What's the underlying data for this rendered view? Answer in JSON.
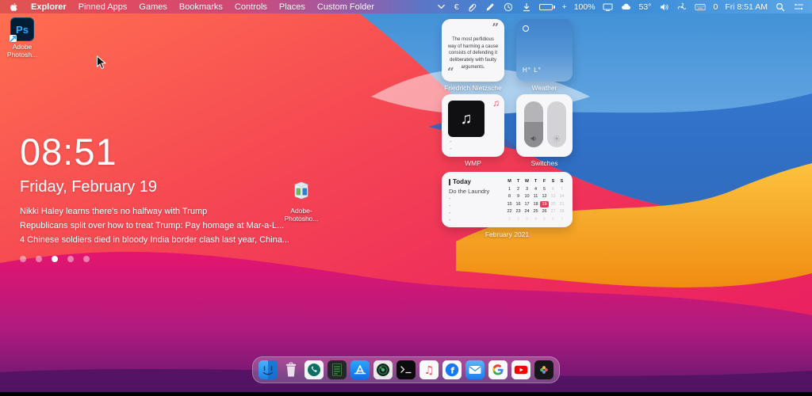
{
  "menubar": {
    "items": [
      "Explorer",
      "Pinned Apps",
      "Games",
      "Bookmarks",
      "Controls",
      "Places",
      "Custom Folder"
    ],
    "active_item": "Explorer",
    "status": {
      "battery_prefix": "+",
      "battery_label": "100%",
      "temperature": "53°",
      "keyboard_count": "0",
      "clock": "Fri 8:51 AM",
      "euro_glyph": "€"
    }
  },
  "desktop": {
    "icons": [
      {
        "type": "photoshop",
        "tile_text": "Ps",
        "label_line1": "Adobe",
        "label_line2": "Photosh..."
      },
      {
        "type": "installer",
        "label_line1": "Adobe-",
        "label_line2": "Photosho..."
      }
    ],
    "clock": {
      "time": "08:51",
      "date": "Friday, February 19"
    },
    "news": [
      "Nikki Haley learns there's no halfway with Trump",
      "Republicans split over how to treat Trump: Pay homage at Mar-a-L...",
      "4 Chinese soldiers died in bloody India border clash last year, China..."
    ],
    "pagination": {
      "count": 5,
      "active": 2
    }
  },
  "widgets": {
    "quote": {
      "text": "The most perfidious way of harming a cause consists of defending it deliberately with faulty arguments.",
      "open_quote": "”",
      "close_quote": "“",
      "label": "Friedrich Nietzsche"
    },
    "weather": {
      "hi_lo": "H° L°",
      "label": "Weather"
    },
    "wmp": {
      "label": "WMP",
      "line1": "-",
      "line2": "-",
      "art_icon": "music-note",
      "corner_icon": "music-note",
      "art_glyph": "♫",
      "corner_glyph": "♫"
    },
    "switches": {
      "label": "Switches",
      "toggles": [
        "volume",
        "brightness"
      ]
    },
    "calendar": {
      "today_label": "Today",
      "event": "Do the Laundry",
      "placeholders": [
        "-",
        "-",
        "-",
        "-"
      ],
      "label": "February 2021",
      "weekdays": [
        "M",
        "T",
        "W",
        "T",
        "F",
        "S",
        "S"
      ],
      "highlight_day": 19,
      "days": [
        {
          "d": 1,
          "s": "n"
        },
        {
          "d": 2,
          "s": "n"
        },
        {
          "d": 3,
          "s": "n"
        },
        {
          "d": 4,
          "s": "n"
        },
        {
          "d": 5,
          "s": "n"
        },
        {
          "d": 6,
          "s": "w"
        },
        {
          "d": 7,
          "s": "w"
        },
        {
          "d": 8,
          "s": "n"
        },
        {
          "d": 9,
          "s": "n"
        },
        {
          "d": 10,
          "s": "n"
        },
        {
          "d": 11,
          "s": "n"
        },
        {
          "d": 12,
          "s": "n"
        },
        {
          "d": 13,
          "s": "w"
        },
        {
          "d": 14,
          "s": "w"
        },
        {
          "d": 15,
          "s": "n"
        },
        {
          "d": 16,
          "s": "n"
        },
        {
          "d": 17,
          "s": "n"
        },
        {
          "d": 18,
          "s": "n"
        },
        {
          "d": 19,
          "s": "a"
        },
        {
          "d": 20,
          "s": "w"
        },
        {
          "d": 21,
          "s": "w"
        },
        {
          "d": 22,
          "s": "n"
        },
        {
          "d": 23,
          "s": "n"
        },
        {
          "d": 24,
          "s": "n"
        },
        {
          "d": 25,
          "s": "n"
        },
        {
          "d": 26,
          "s": "n"
        },
        {
          "d": 27,
          "s": "w"
        },
        {
          "d": 28,
          "s": "w"
        },
        {
          "d": 1,
          "s": "f"
        },
        {
          "d": 2,
          "s": "f"
        },
        {
          "d": 3,
          "s": "f"
        },
        {
          "d": 4,
          "s": "f"
        },
        {
          "d": 5,
          "s": "f"
        },
        {
          "d": 6,
          "s": "f"
        },
        {
          "d": 7,
          "s": "f"
        }
      ]
    }
  },
  "dock": {
    "items": [
      {
        "name": "finder"
      },
      {
        "name": "trash"
      },
      {
        "name": "phone"
      },
      {
        "name": "notes-ledger"
      },
      {
        "name": "app-store"
      },
      {
        "name": "camera-lens"
      },
      {
        "name": "terminal"
      },
      {
        "name": "music"
      },
      {
        "name": "facebook"
      },
      {
        "name": "mail"
      },
      {
        "name": "google"
      },
      {
        "name": "youtube"
      },
      {
        "name": "photos-dark"
      }
    ]
  }
}
